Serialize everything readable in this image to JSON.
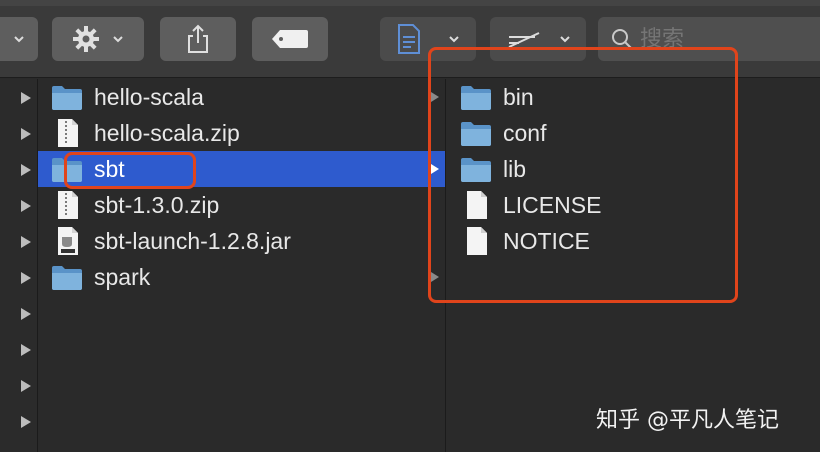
{
  "toolbar": {
    "search": {
      "placeholder": "搜索"
    },
    "icons": [
      "gear-icon",
      "share-icon",
      "tag-icon",
      "document-icon",
      "view-options-icon",
      "search-icon"
    ]
  },
  "columns": {
    "middle": {
      "items": [
        {
          "name": "hello-scala",
          "kind": "folder",
          "has_children": true
        },
        {
          "name": "hello-scala.zip",
          "kind": "zip",
          "has_children": false
        },
        {
          "name": "sbt",
          "kind": "folder",
          "has_children": true,
          "selected": true
        },
        {
          "name": "sbt-1.3.0.zip",
          "kind": "zip",
          "has_children": false
        },
        {
          "name": "sbt-launch-1.2.8.jar",
          "kind": "jar",
          "has_children": false
        },
        {
          "name": "spark",
          "kind": "folder",
          "has_children": true
        }
      ]
    },
    "right": {
      "items": [
        {
          "name": "bin",
          "kind": "folder"
        },
        {
          "name": "conf",
          "kind": "folder"
        },
        {
          "name": "lib",
          "kind": "folder"
        },
        {
          "name": "LICENSE",
          "kind": "file"
        },
        {
          "name": "NOTICE",
          "kind": "file"
        }
      ]
    }
  },
  "colors": {
    "selection": "#2e5bce",
    "annotation": "#e0441b",
    "folder": "#7fb3dd"
  },
  "watermark": "知乎 @平凡人笔记"
}
